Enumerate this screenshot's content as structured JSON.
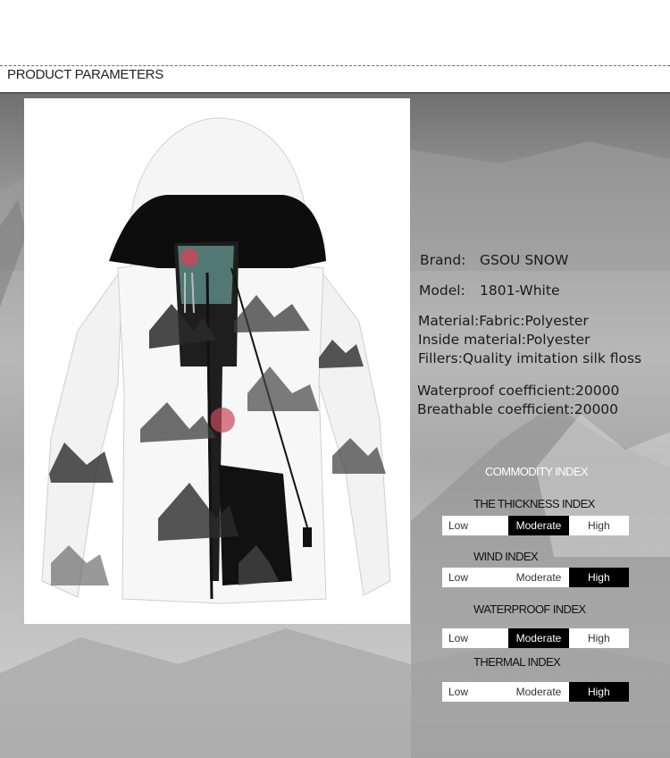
{
  "header": {
    "title": "PRODUCT PARAMETERS"
  },
  "product": {
    "image": "ski-jacket-white-mountain-print",
    "specs": {
      "brand_label": "Brand:",
      "brand_value": "GSOU SNOW",
      "model_label": "Model:",
      "model_value": "1801-White",
      "material": "Material:Fabric:Polyester",
      "inside_material": "Inside material:Polyester",
      "fillers": "Fillers:Quality imitation silk floss",
      "waterproof": "Waterproof coefficient:20000",
      "breathable": "Breathable coefficient:20000"
    }
  },
  "commodity_index": {
    "title": "COMMODITY INDEX",
    "scale_labels": {
      "low": "Low",
      "moderate": "Moderate",
      "high": "High"
    },
    "indices": [
      {
        "name": "THE THICKNESS INDEX",
        "level": "Moderate"
      },
      {
        "name": "WIND INDEX",
        "level": "High"
      },
      {
        "name": "WATERPROOF INDEX",
        "level": "Moderate"
      },
      {
        "name": "THERMAL INDEX",
        "level": "High"
      }
    ]
  },
  "colors": {
    "active": "#000000",
    "inactive": "#ffffff",
    "background": "#b0b0b0"
  }
}
